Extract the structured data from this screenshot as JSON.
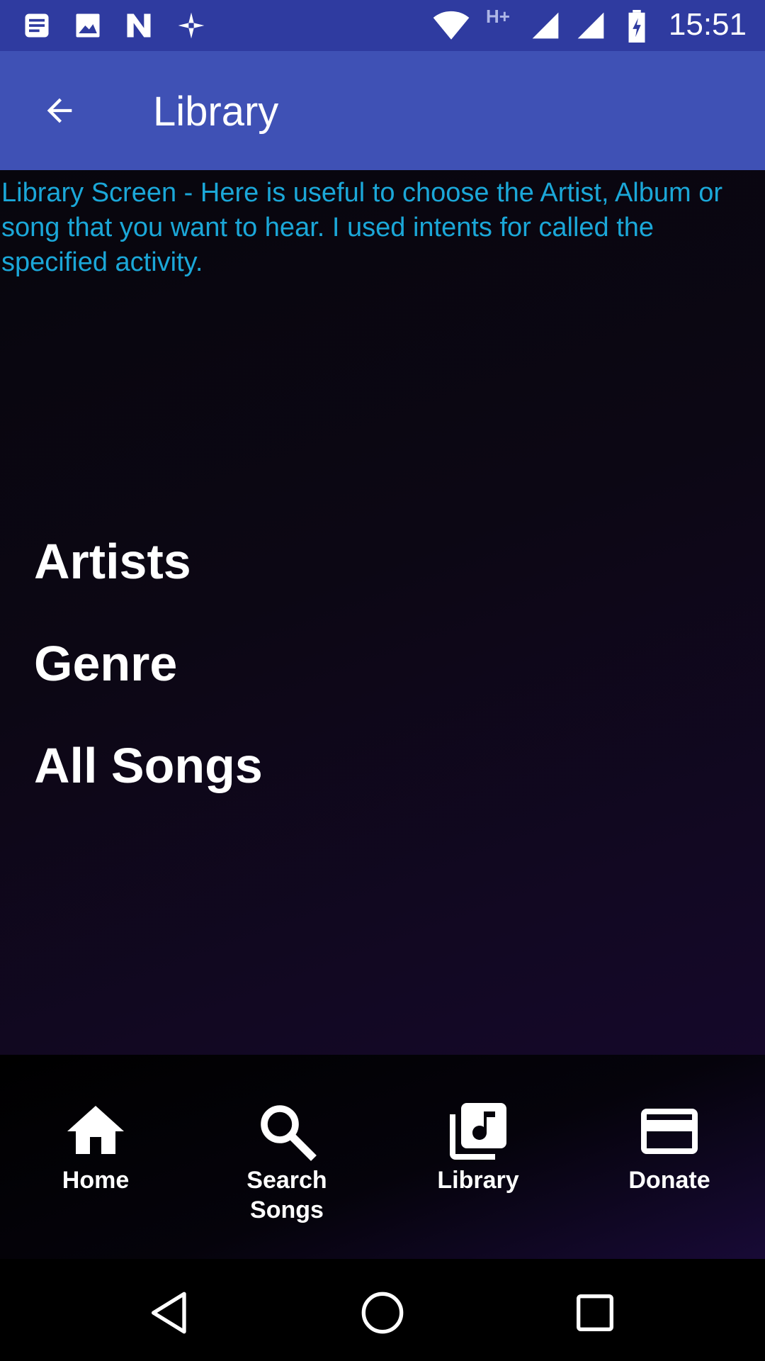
{
  "status_bar": {
    "time": "15:51",
    "network_type": "H+",
    "icons": [
      "notes-icon",
      "image-icon",
      "n-app-icon",
      "pinwheel-icon",
      "wifi-icon",
      "signal-icon",
      "signal-icon",
      "battery-charging-icon"
    ]
  },
  "app_bar": {
    "title": "Library",
    "back_icon": "arrow-back-icon"
  },
  "content": {
    "description": "Library Screen - Here is useful to choose the Artist, Album or song that you want to hear. I used intents for called the specified activity.",
    "items": [
      {
        "label": "Artists"
      },
      {
        "label": "Genre"
      },
      {
        "label": "All Songs"
      }
    ]
  },
  "bottom_nav": {
    "items": [
      {
        "label": "Home",
        "icon": "home-icon"
      },
      {
        "label": "Search\nSongs",
        "icon": "search-icon"
      },
      {
        "label": "Library",
        "icon": "library-music-icon"
      },
      {
        "label": "Donate",
        "icon": "credit-card-icon"
      }
    ]
  },
  "system_nav": {
    "buttons": [
      "back-triangle-icon",
      "home-circle-icon",
      "recents-square-icon"
    ]
  },
  "colors": {
    "status_bar": "#2f3ba0",
    "app_bar": "#3f51b5",
    "description_text": "#1ba7d8",
    "item_text": "#ffffff"
  }
}
